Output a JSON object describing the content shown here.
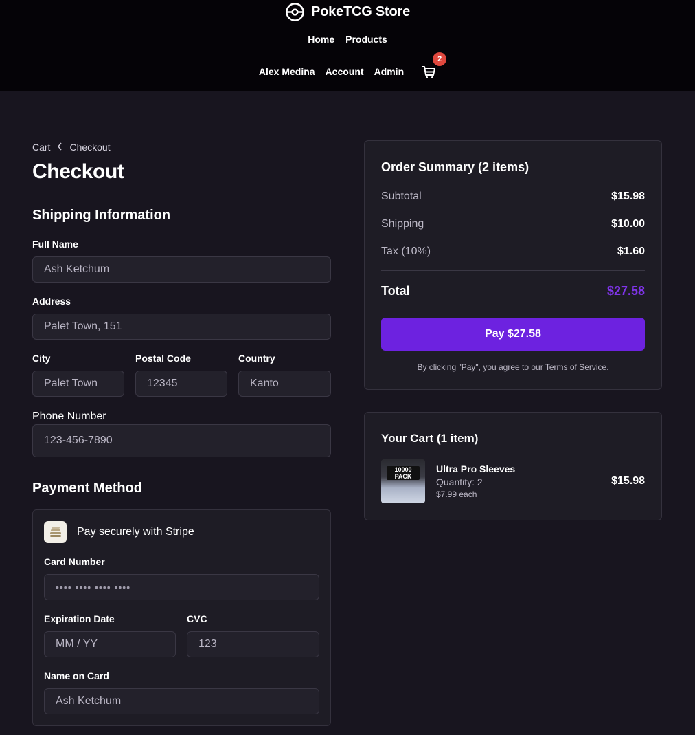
{
  "header": {
    "brand": "PokeTCG Store",
    "nav_primary": [
      "Home",
      "Products"
    ],
    "user_name": "Alex Medina",
    "account_label": "Account",
    "admin_label": "Admin",
    "cart_count": "2"
  },
  "breadcrumb": {
    "cart": "Cart",
    "current": "Checkout"
  },
  "page_title": "Checkout",
  "shipping": {
    "title": "Shipping Information",
    "full_name_label": "Full Name",
    "full_name_value": "Ash Ketchum",
    "address_label": "Address",
    "address_value": "Palet Town, 151",
    "city_label": "City",
    "city_value": "Palet Town",
    "postal_label": "Postal Code",
    "postal_value": "12345",
    "country_label": "Country",
    "country_value": "Kanto",
    "phone_label": "Phone Number",
    "phone_value": "123-456-7890"
  },
  "payment": {
    "title": "Payment Method",
    "provider_text": "Pay securely with Stripe",
    "card_number_label": "Card Number",
    "card_number_placeholder": "•••• •••• •••• ••••",
    "expiration_label": "Expiration Date",
    "expiration_placeholder": "MM / YY",
    "cvc_label": "CVC",
    "cvc_placeholder": "123",
    "name_on_card_label": "Name on Card",
    "name_on_card_value": "Ash Ketchum"
  },
  "order_summary": {
    "title": "Order Summary (2 items)",
    "subtotal_label": "Subtotal",
    "subtotal_value": "$15.98",
    "shipping_label": "Shipping",
    "shipping_value": "$10.00",
    "tax_label": "Tax (10%)",
    "tax_value": "$1.60",
    "total_label": "Total",
    "total_value": "$27.58",
    "pay_button": "Pay $27.58",
    "terms_prefix": "By clicking \"Pay\", you agree to our ",
    "terms_link": "Terms of Service",
    "terms_suffix": "."
  },
  "cart": {
    "title": "Your Cart (1 item)",
    "items": [
      {
        "name": "Ultra Pro Sleeves",
        "quantity": "Quantity: 2",
        "each": "$7.99 each",
        "price": "$15.98",
        "thumb_text": "10000 PACK"
      }
    ]
  },
  "colors": {
    "background": "#18151f",
    "header": "#050307",
    "accent": "#6d22e0",
    "total": "#7f34e8",
    "badge": "#e0483e"
  }
}
